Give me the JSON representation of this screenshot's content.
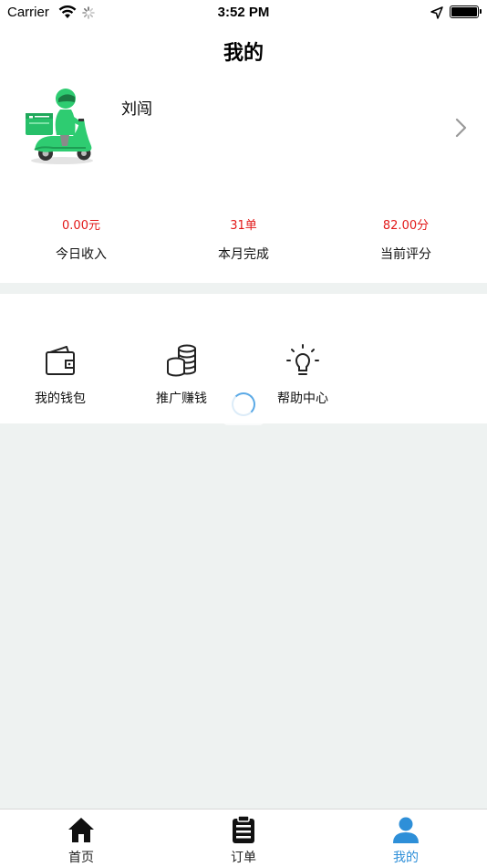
{
  "status_bar": {
    "carrier": "Carrier",
    "time": "3:52 PM"
  },
  "header": {
    "title": "我的"
  },
  "profile": {
    "name": "刘闯",
    "avatar_icon": "delivery-rider-scooter-icon",
    "stats": [
      {
        "value": "0.00元",
        "label": "今日收入"
      },
      {
        "value": "31单",
        "label": "本月完成"
      },
      {
        "value": "82.00分",
        "label": "当前评分"
      }
    ]
  },
  "menu": {
    "items": [
      {
        "label": "我的钱包",
        "icon": "wallet-icon"
      },
      {
        "label": "推广赚钱",
        "icon": "coins-icon"
      },
      {
        "label": "帮助中心",
        "icon": "lightbulb-icon"
      }
    ]
  },
  "tabs": [
    {
      "label": "首页",
      "icon": "home-icon"
    },
    {
      "label": "订单",
      "icon": "order-list-icon"
    },
    {
      "label": "我的",
      "icon": "user-icon",
      "active": true
    }
  ],
  "colors": {
    "stat_value": "#e21a1a",
    "active_tab": "#2e8fd8",
    "background": "#eef2f1",
    "brand_green": "#2ecc71"
  }
}
